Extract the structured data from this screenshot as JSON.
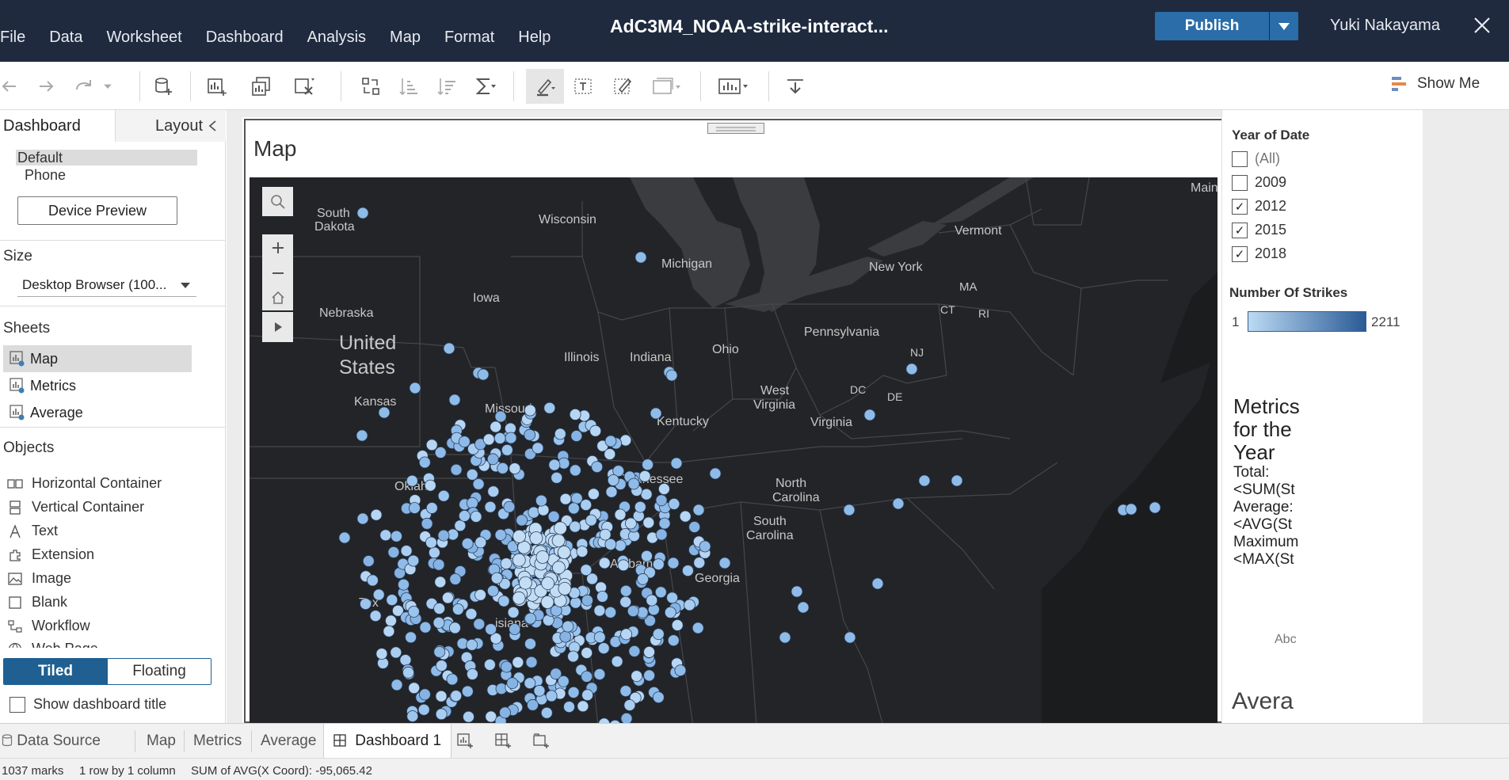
{
  "app": {
    "workbook_title": "AdC3M4_NOAA-strike-interact...",
    "user_name": "Yuki Nakayama",
    "publish_label": "Publish"
  },
  "menu": [
    "File",
    "Data",
    "Worksheet",
    "Dashboard",
    "Analysis",
    "Map",
    "Format",
    "Help"
  ],
  "toolbar": {
    "show_me_label": "Show Me"
  },
  "left_pane": {
    "tab_dashboard": "Dashboard",
    "tab_layout": "Layout",
    "device_default": "Default",
    "device_phone": "Phone",
    "device_preview_label": "Device Preview",
    "size_heading": "Size",
    "size_value": "Desktop Browser (100...",
    "sheets_heading": "Sheets",
    "sheets": [
      "Map",
      "Metrics",
      "Average"
    ],
    "objects_heading": "Objects",
    "objects": [
      "Horizontal Container",
      "Vertical Container",
      "Text",
      "Extension",
      "Image",
      "Blank",
      "Workflow",
      "Web Page"
    ],
    "tiled_label": "Tiled",
    "floating_label": "Floating",
    "show_title_label": "Show dashboard title"
  },
  "dashboard": {
    "map_title": "Map",
    "map_labels": {
      "south_dakota_1": "South",
      "south_dakota_2": "Dakota",
      "wisconsin": "Wisconsin",
      "michigan": "Michigan",
      "maine": "Maine",
      "vermont": "Vermont",
      "new_york": "New York",
      "ma": "MA",
      "ct": "CT",
      "ri": "RI",
      "nebraska": "Nebraska",
      "iowa": "Iowa",
      "united_states_1": "United",
      "united_states_2": "States",
      "pennsylvania": "Pennsylvania",
      "illinois": "Illinois",
      "indiana": "Indiana",
      "ohio": "Ohio",
      "nj": "NJ",
      "kansas": "Kansas",
      "missouri": "Missouri",
      "west_virginia_1": "West",
      "west_virginia_2": "Virginia",
      "dc": "DC",
      "de": "DE",
      "virginia": "Virginia",
      "kentucky": "Kentucky",
      "oklahoma": "Oklah",
      "tennessee": "Tennessee",
      "north_carolina_1": "North",
      "north_carolina_2": "Carolina",
      "south_carolina_1": "South",
      "south_carolina_2": "Carolina",
      "alabama": "Alabama",
      "georgia": "Georgia",
      "texas": "Tex",
      "louisiana": "isiana"
    },
    "filter_title": "Year of Date",
    "filter_items": [
      {
        "label": "(All)",
        "checked": false
      },
      {
        "label": "2009",
        "checked": false
      },
      {
        "label": "2012",
        "checked": true
      },
      {
        "label": "2015",
        "checked": true
      },
      {
        "label": "2018",
        "checked": true
      }
    ],
    "legend_title": "Number Of Strikes",
    "legend_min": "1",
    "legend_max": "2211",
    "legend_colors": [
      "#bcdaf3",
      "#2a5b96"
    ],
    "metrics_title": "Metrics for the Year",
    "metrics_lines": [
      "Total:",
      "<SUM(St",
      "Average:",
      "<AVG(St",
      "Maximum",
      "<MAX(St"
    ],
    "abc_placeholder": "Abc",
    "average_title": "Avera"
  },
  "sheet_tabs": [
    "Data Source",
    "Map",
    "Metrics",
    "Average",
    "Dashboard 1"
  ],
  "status": {
    "marks": "1037 marks",
    "rows_cols": "1 row by 1 column",
    "sum": "SUM of AVG(X Coord): -95,065.42"
  }
}
